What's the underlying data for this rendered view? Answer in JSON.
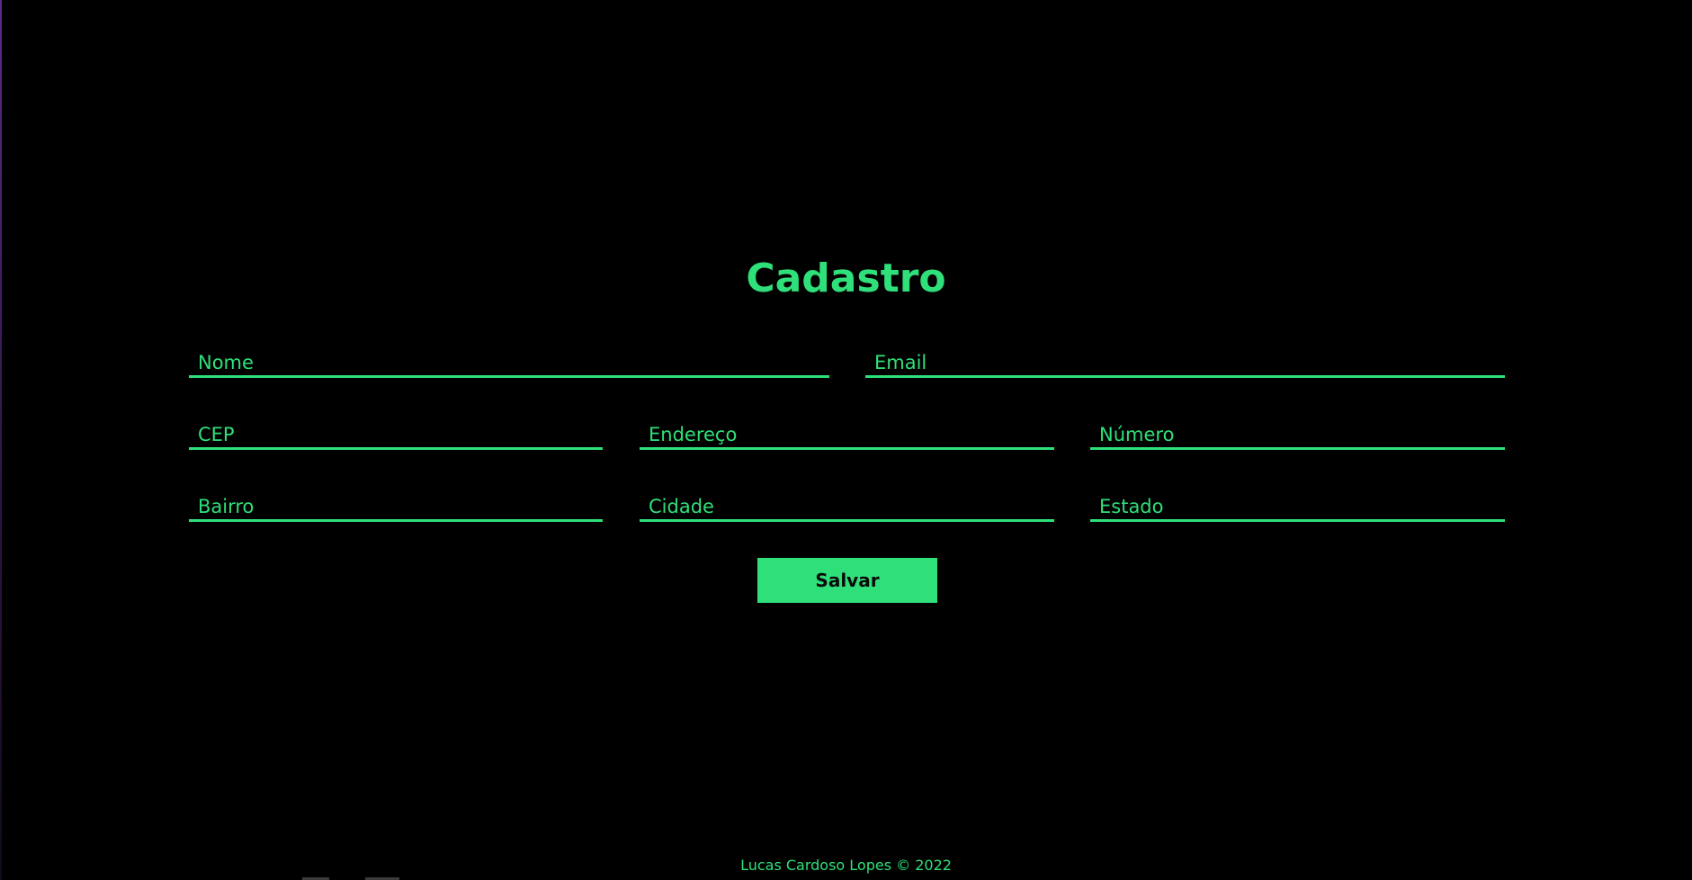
{
  "page": {
    "title": "Cadastro"
  },
  "form": {
    "nome": {
      "placeholder": "Nome",
      "value": ""
    },
    "email": {
      "placeholder": "Email",
      "value": ""
    },
    "cep": {
      "placeholder": "CEP",
      "value": ""
    },
    "endereco": {
      "placeholder": "Endereço",
      "value": ""
    },
    "numero": {
      "placeholder": "Número",
      "value": ""
    },
    "bairro": {
      "placeholder": "Bairro",
      "value": ""
    },
    "cidade": {
      "placeholder": "Cidade",
      "value": ""
    },
    "estado": {
      "placeholder": "Estado",
      "value": ""
    },
    "save_label": "Salvar"
  },
  "footer": {
    "text": "Lucas Cardoso Lopes © 2022"
  },
  "colors": {
    "background": "#000000",
    "accent": "#2fe07a",
    "button_text": "#0a0a0a"
  }
}
